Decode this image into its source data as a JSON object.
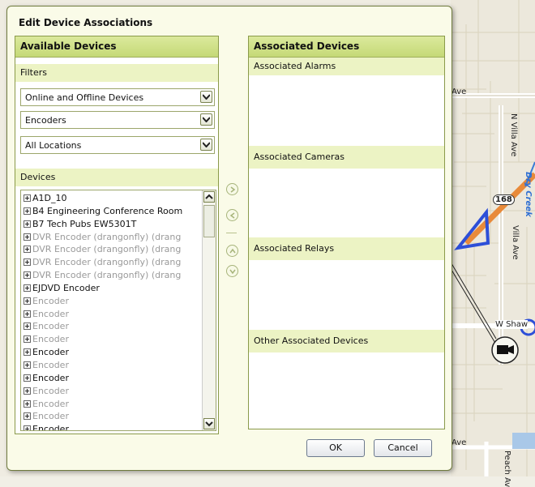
{
  "dialog": {
    "title": "Edit Device Associations",
    "available": {
      "header": "Available Devices",
      "filters_label": "Filters",
      "filter_status": "Online and Offline Devices",
      "filter_type": "Encoders",
      "filter_location": "All Locations",
      "devices_label": "Devices",
      "devices": [
        {
          "label": "A1D_10",
          "online": true
        },
        {
          "label": "B4 Engineering Conference Room",
          "online": true
        },
        {
          "label": "B7 Tech Pubs EW5301T",
          "online": true
        },
        {
          "label": "DVR Encoder (drangonfly) (drang",
          "online": false
        },
        {
          "label": "DVR Encoder (drangonfly) (drang",
          "online": false
        },
        {
          "label": "DVR Encoder (drangonfly) (drang",
          "online": false
        },
        {
          "label": "DVR Encoder (drangonfly) (drang",
          "online": false
        },
        {
          "label": "EJDVD Encoder",
          "online": true
        },
        {
          "label": "Encoder",
          "online": false
        },
        {
          "label": "Encoder",
          "online": false
        },
        {
          "label": "Encoder",
          "online": false
        },
        {
          "label": "Encoder",
          "online": false
        },
        {
          "label": "Encoder",
          "online": true
        },
        {
          "label": "Encoder",
          "online": false
        },
        {
          "label": "Encoder",
          "online": true
        },
        {
          "label": "Encoder",
          "online": false
        },
        {
          "label": "Encoder",
          "online": false
        },
        {
          "label": "Encoder",
          "online": false
        },
        {
          "label": "Encoder",
          "online": true
        }
      ]
    },
    "associated": {
      "header": "Associated Devices",
      "alarms": "Associated Alarms",
      "cameras": "Associated Cameras",
      "relays": "Associated Relays",
      "other": "Other Associated Devices"
    },
    "buttons": {
      "ok": "OK",
      "cancel": "Cancel"
    }
  },
  "map": {
    "labels": {
      "ave_top": "Ave",
      "n_villa_ave": "N Villa Ave",
      "dry_creek": "Dry Creek",
      "route": "168",
      "villa_ave": "Villa Ave",
      "w_shaw": "W Shaw",
      "ave_bottom": "Ave",
      "peach_ave": "Peach Av"
    }
  },
  "colors": {
    "accent": "#c5d977",
    "panel_border": "#8a9a4a",
    "road_orange": "#e88a3a",
    "boundary_blue": "#2d4fd8"
  }
}
